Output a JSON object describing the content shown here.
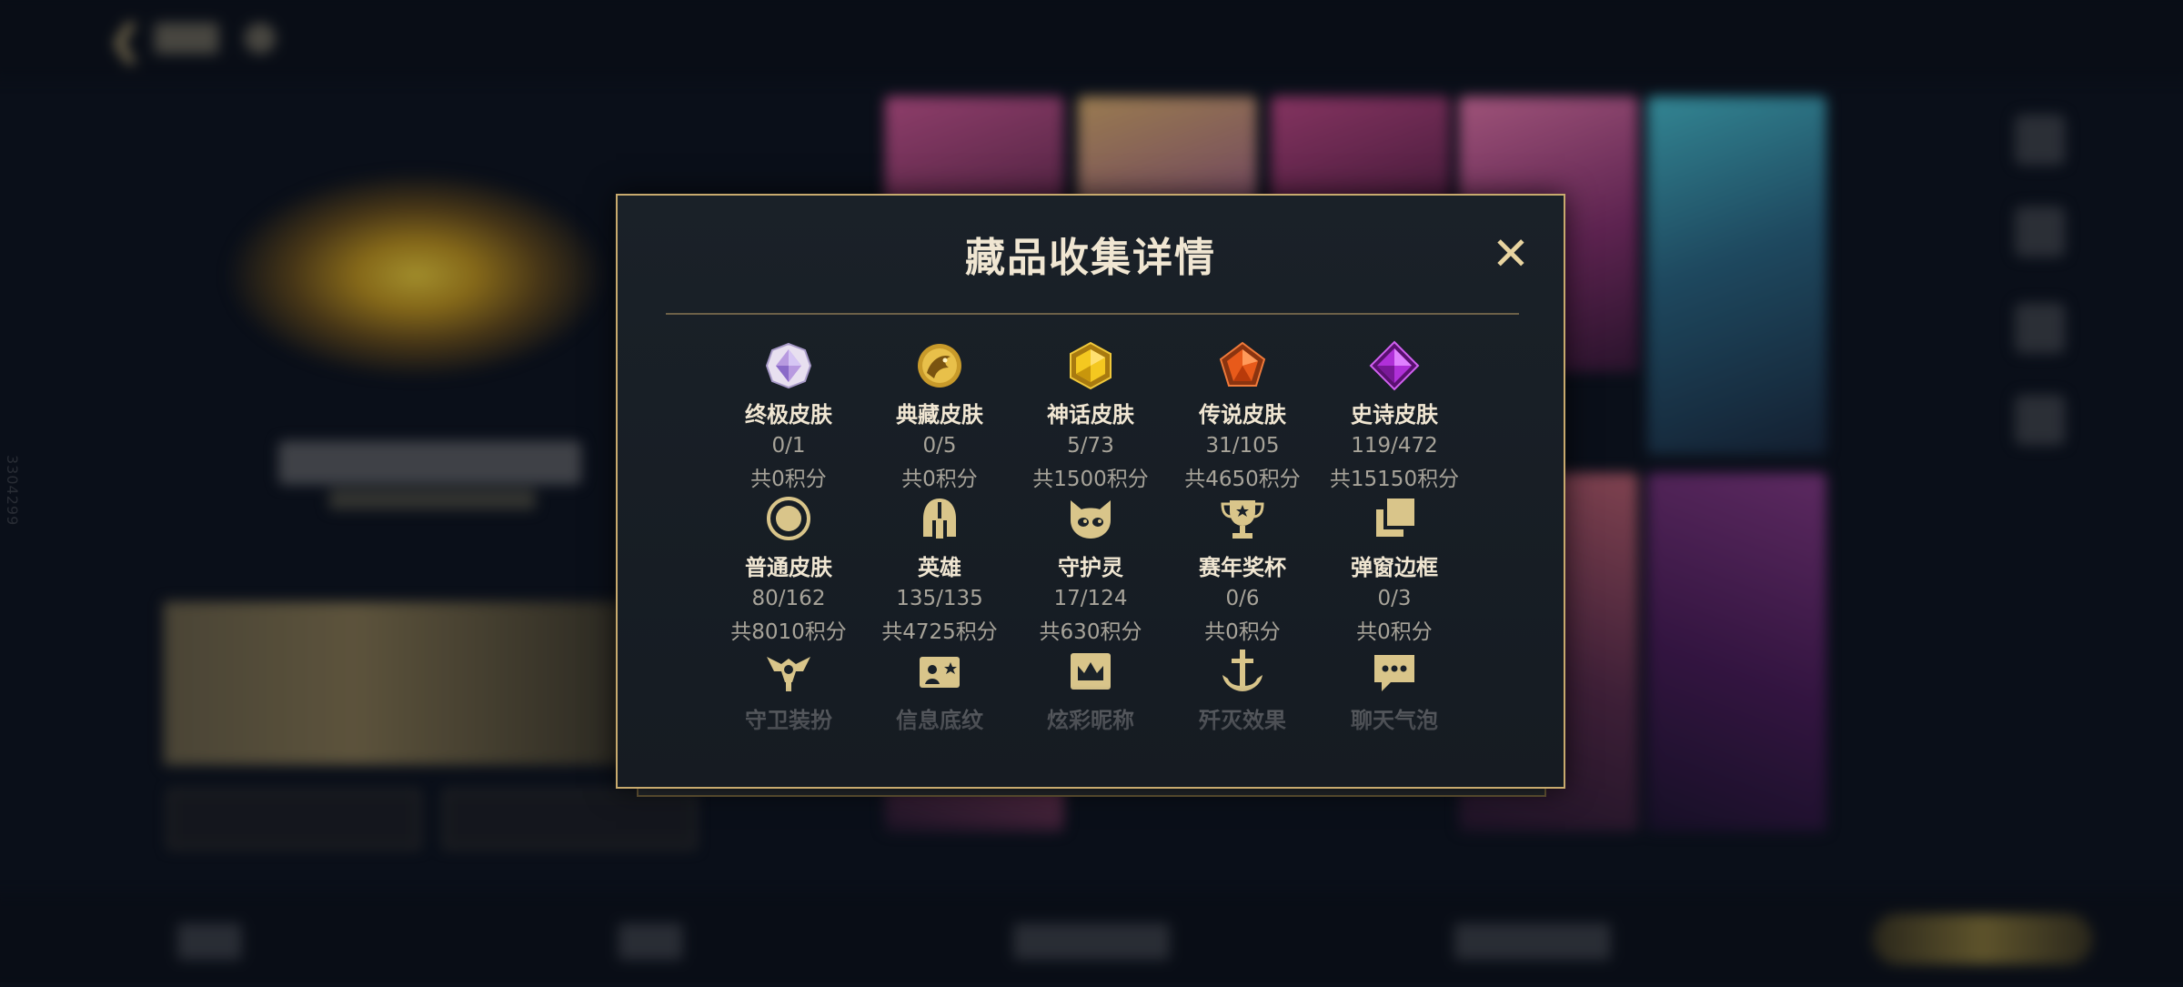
{
  "modal": {
    "title": "藏品收集详情",
    "close_symbol": "✕"
  },
  "categories": [
    {
      "icon": "ultimate-skin-icon",
      "name": "终极皮肤",
      "count": "0/1",
      "points": "共0积分"
    },
    {
      "icon": "prestige-skin-icon",
      "name": "典藏皮肤",
      "count": "0/5",
      "points": "共0积分"
    },
    {
      "icon": "mythic-skin-icon",
      "name": "神话皮肤",
      "count": "5/73",
      "points": "共1500积分"
    },
    {
      "icon": "legendary-skin-icon",
      "name": "传说皮肤",
      "count": "31/105",
      "points": "共4650积分"
    },
    {
      "icon": "epic-skin-icon",
      "name": "史诗皮肤",
      "count": "119/472",
      "points": "共15150积分"
    },
    {
      "icon": "standard-skin-icon",
      "name": "普通皮肤",
      "count": "80/162",
      "points": "共8010积分"
    },
    {
      "icon": "helmet-icon",
      "name": "英雄",
      "count": "135/135",
      "points": "共4725积分"
    },
    {
      "icon": "little-legend-icon",
      "name": "守护灵",
      "count": "17/124",
      "points": "共630积分"
    },
    {
      "icon": "trophy-icon",
      "name": "赛年奖杯",
      "count": "0/6",
      "points": "共0积分"
    },
    {
      "icon": "frames-icon",
      "name": "弹窗边框",
      "count": "0/3",
      "points": "共0积分"
    },
    {
      "icon": "ward-icon",
      "name": "守卫装扮",
      "count": "",
      "points": ""
    },
    {
      "icon": "banner-icon",
      "name": "信息底纹",
      "count": "",
      "points": ""
    },
    {
      "icon": "crown-icon",
      "name": "炫彩昵称",
      "count": "",
      "points": ""
    },
    {
      "icon": "anchor-icon",
      "name": "歼灭效果",
      "count": "",
      "points": ""
    },
    {
      "icon": "chat-bubble-icon",
      "name": "聊天气泡",
      "count": "",
      "points": ""
    }
  ],
  "colors": {
    "gold_border": "#c8aa6e",
    "title_text": "#f0e6d2",
    "sub_text": "#a8a49a",
    "icon_gold": "#d9c58a"
  },
  "background": {
    "side_id": "3304299"
  }
}
